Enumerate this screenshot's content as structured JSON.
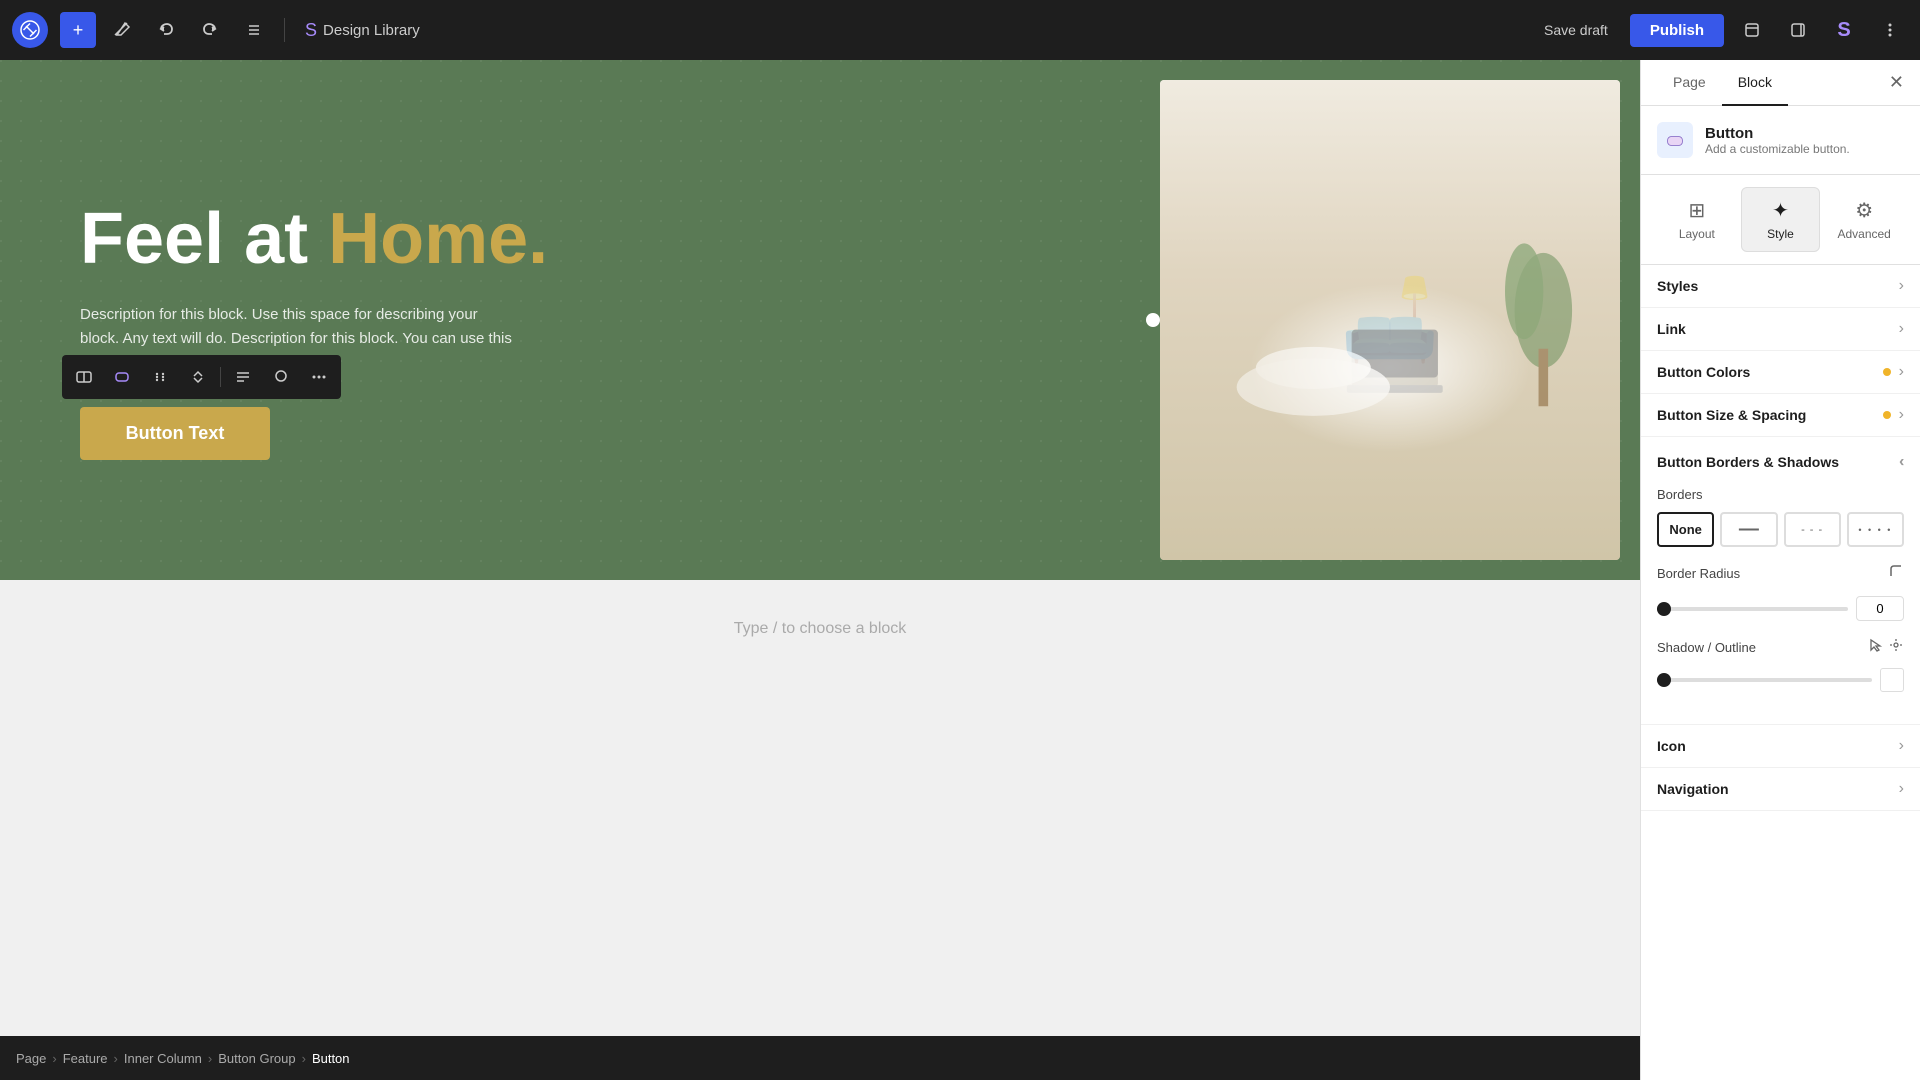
{
  "toolbar": {
    "add_label": "+",
    "wp_logo": "W",
    "design_library": "Design Library",
    "save_draft": "Save draft",
    "publish": "Publish"
  },
  "canvas": {
    "hero": {
      "title_plain": "Feel at ",
      "title_highlight": "Home.",
      "description": "Description for this block. Use this space for describing your block. Any text will do. Description for this block. You can use this space for describing your",
      "button_text": "Button Text",
      "type_placeholder": "Type / to choose a block"
    }
  },
  "breadcrumb": {
    "items": [
      "Page",
      "Feature",
      "Inner Column",
      "Button Group",
      "Button"
    ]
  },
  "panel": {
    "tabs": [
      "Page",
      "Block"
    ],
    "active_tab": "Block",
    "block_name": "Button",
    "block_desc": "Add a customizable button.",
    "style_tabs": [
      {
        "label": "Layout",
        "icon": "⊞"
      },
      {
        "label": "Style",
        "icon": "✦"
      },
      {
        "label": "Advanced",
        "icon": "⚙"
      }
    ],
    "active_style_tab": "Style",
    "sections": {
      "styles": "Styles",
      "link": "Link",
      "button_colors": "Button Colors",
      "button_size_spacing": "Button Size & Spacing",
      "button_borders_shadows": "Button Borders & Shadows",
      "icon": "Icon",
      "navigation": "Navigation"
    },
    "borders": {
      "label": "Borders",
      "options": [
        "None",
        "—",
        "- - -",
        "• • • •"
      ],
      "active": "None"
    },
    "border_radius": {
      "label": "Border Radius",
      "value": "0"
    },
    "shadow_outline": {
      "label": "Shadow / Outline"
    }
  }
}
